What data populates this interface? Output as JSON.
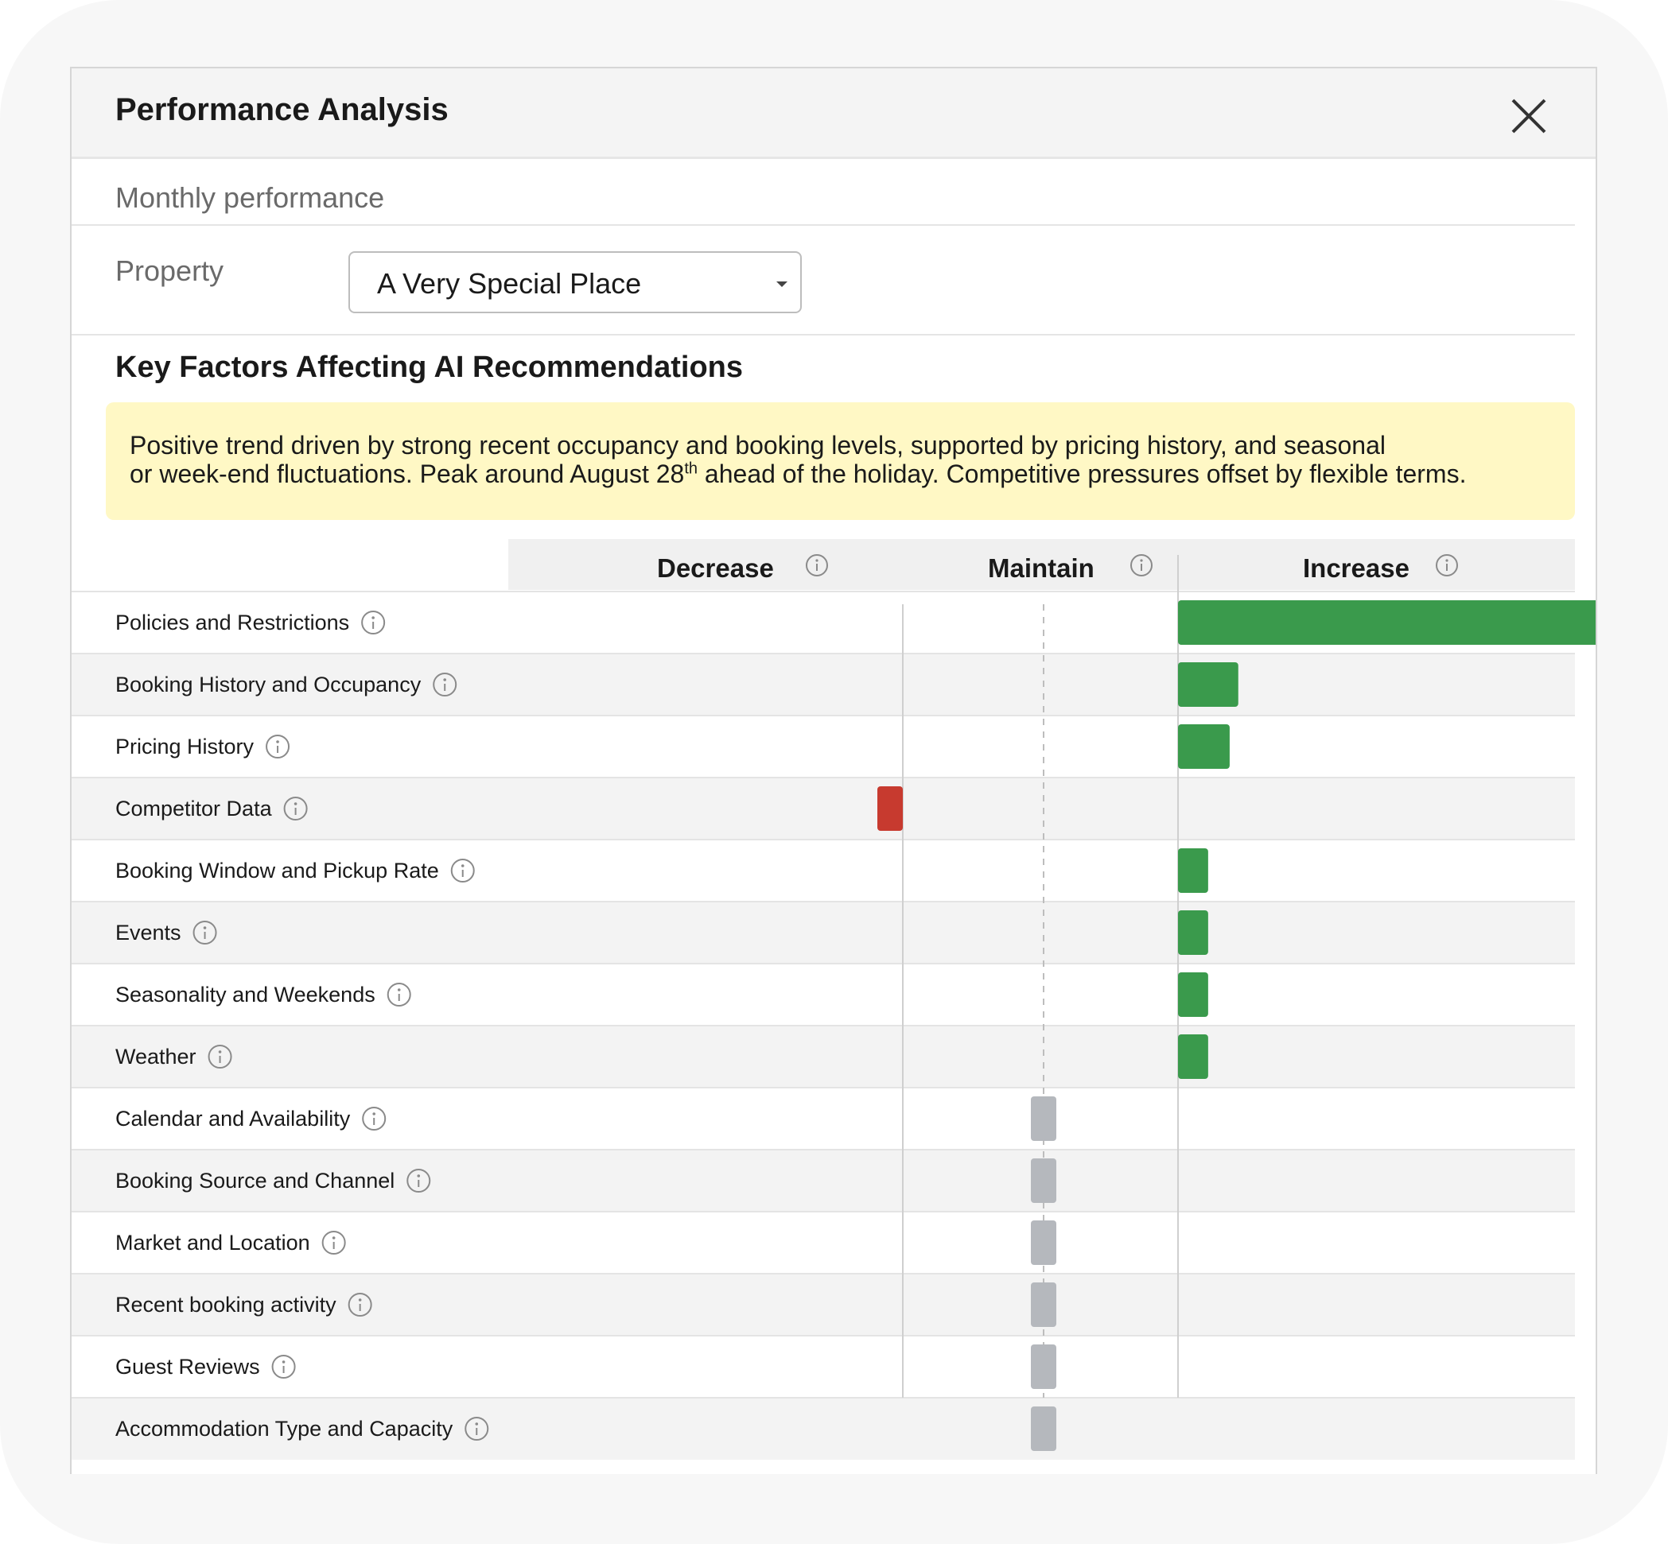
{
  "panel": {
    "title": "Performance Analysis",
    "section": "Monthly performance",
    "property_label": "Property",
    "property_value": "A Very Special Place",
    "factors_title": "Key Factors Affecting AI Recommendations",
    "summary_line1": "Positive trend driven by strong recent occupancy and booking levels, supported by pricing history, and seasonal",
    "summary_line2_a": "or week-end fluctuations. Peak around August 28",
    "summary_line2_sup": "th",
    "summary_line2_b": " ahead of the holiday. Competitive pressures offset by flexible terms."
  },
  "columns": {
    "decrease": "Decrease",
    "maintain": "Maintain",
    "increase": "Increase"
  },
  "colors": {
    "increase": "#3a9a4c",
    "decrease": "#c73a2f",
    "maintain": "#b5b8bd"
  },
  "chart_data": {
    "type": "bar",
    "categories": [
      "Policies and Restrictions",
      "Booking History and Occupancy",
      "Pricing History",
      "Competitor Data",
      "Booking Window and Pickup Rate",
      "Events",
      "Seasonality and Weekends",
      "Weather",
      "Calendar and Availability",
      "Booking Source and Channel",
      "Market and Location",
      "Recent booking activity",
      "Guest Reviews",
      "Accommodation Type and Capacity"
    ],
    "direction": [
      "increase",
      "increase",
      "increase",
      "decrease",
      "increase",
      "increase",
      "increase",
      "increase",
      "maintain",
      "maintain",
      "maintain",
      "maintain",
      "maintain",
      "maintain"
    ],
    "values": [
      1.0,
      0.14,
      0.12,
      0.11,
      0.07,
      0.07,
      0.07,
      0.07,
      0,
      0,
      0,
      0,
      0,
      0
    ]
  }
}
